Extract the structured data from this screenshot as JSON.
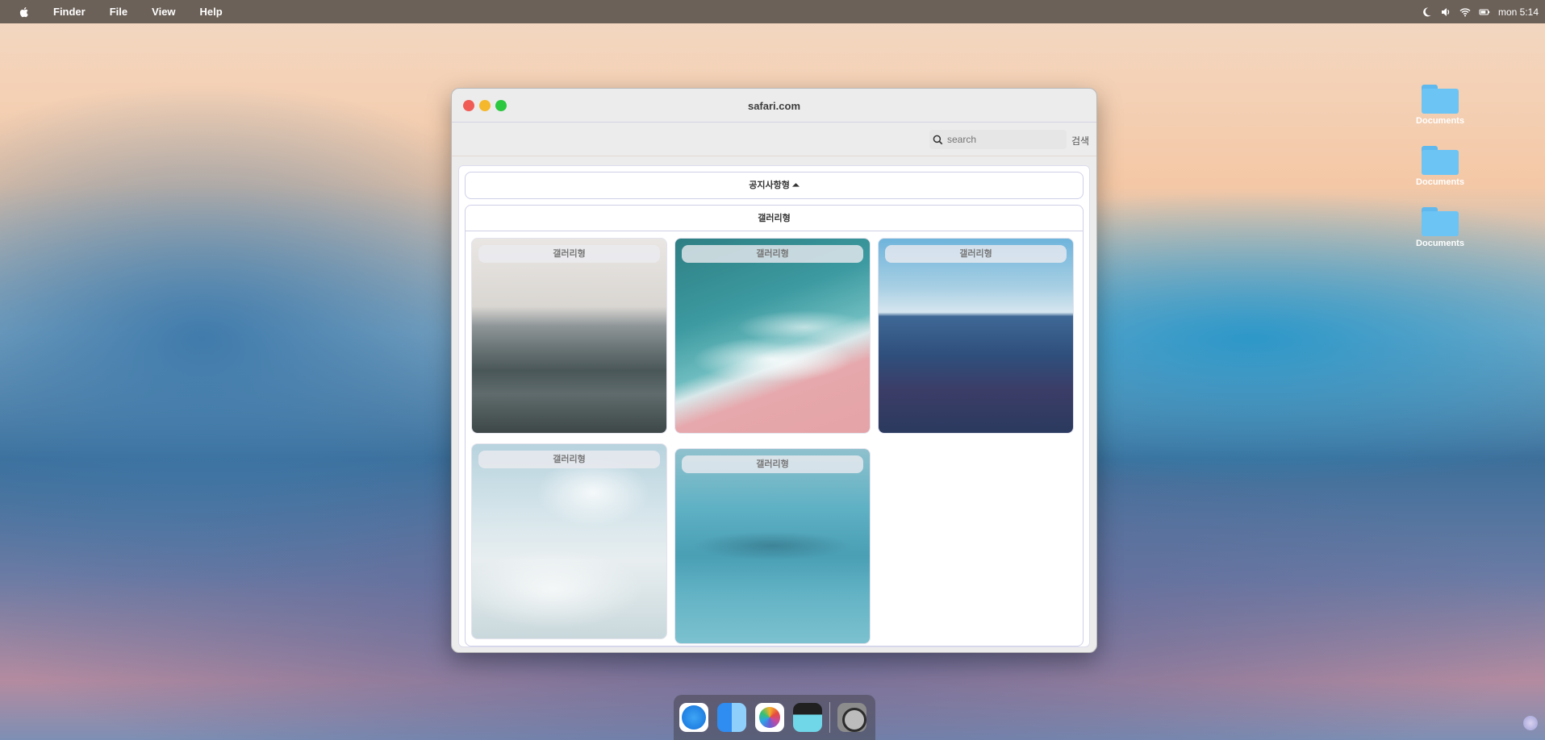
{
  "menubar": {
    "app_name": "Finder",
    "menus": [
      "File",
      "View",
      "Help"
    ],
    "clock": "mon 5:14"
  },
  "desktop": {
    "icons": [
      {
        "label": "Documents"
      },
      {
        "label": "Documents"
      },
      {
        "label": "Documents"
      }
    ]
  },
  "window": {
    "title": "safari.com",
    "search": {
      "placeholder": "search",
      "button_label": "검색"
    },
    "notice_label": "공지사항형 ⏶",
    "gallery_title": "갤러리형",
    "gallery_items": [
      {
        "label": "갤러리형"
      },
      {
        "label": "갤러리형"
      },
      {
        "label": "갤러리형"
      },
      {
        "label": "갤러리형"
      },
      {
        "label": "갤러리형"
      }
    ]
  },
  "dock": {
    "apps": [
      "Safari",
      "Finder",
      "Photos",
      "Clips",
      "System Settings"
    ]
  },
  "colors": {
    "menubar": "#6b6158",
    "close": "#f15b55",
    "minimize": "#f5b82c",
    "zoom": "#2bc840",
    "folder": "#6cc4f5"
  }
}
